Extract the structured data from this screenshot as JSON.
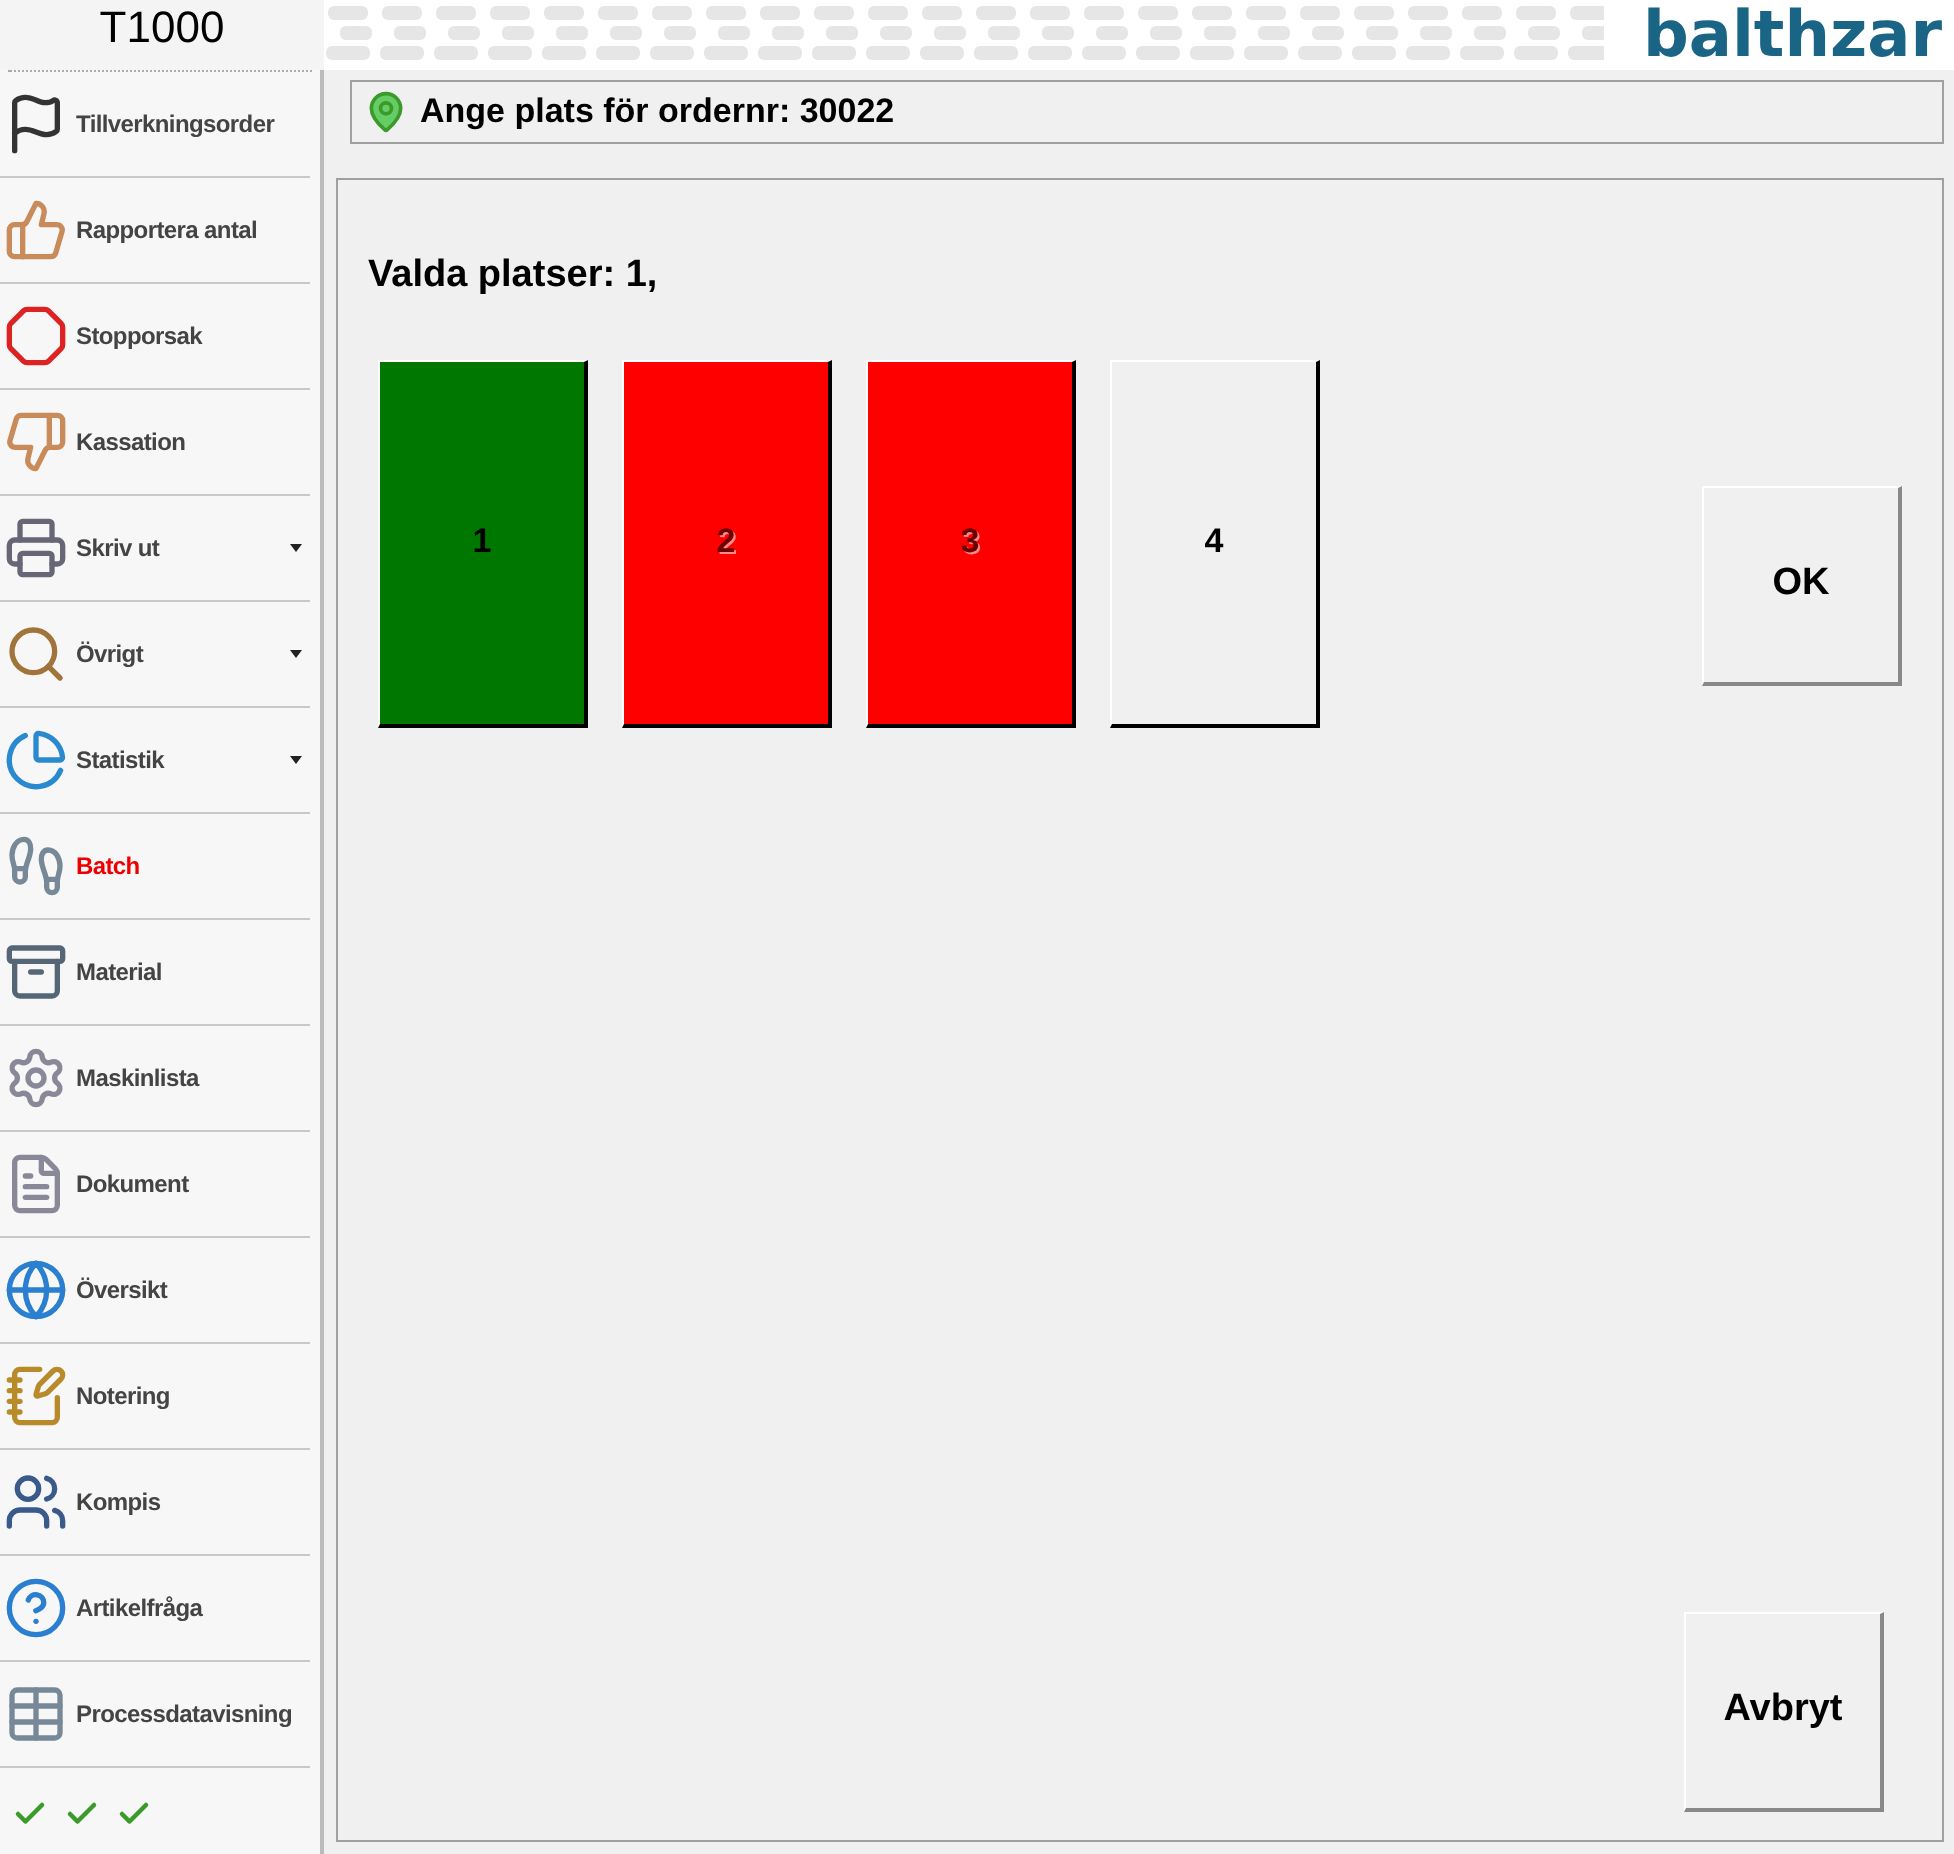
{
  "app_title": "T1000",
  "logo": "balthzar",
  "sidebar": {
    "items": [
      {
        "label": "Tillverkningsorder",
        "selected": false,
        "has_menu": false
      },
      {
        "label": "Rapportera antal",
        "selected": false,
        "has_menu": false
      },
      {
        "label": "Stopporsak",
        "selected": false,
        "has_menu": false
      },
      {
        "label": "Kassation",
        "selected": false,
        "has_menu": false
      },
      {
        "label": "Skriv ut",
        "selected": false,
        "has_menu": true
      },
      {
        "label": "Övrigt",
        "selected": false,
        "has_menu": true
      },
      {
        "label": "Statistik",
        "selected": false,
        "has_menu": true
      },
      {
        "label": "Batch",
        "selected": true,
        "has_menu": false
      },
      {
        "label": "Material",
        "selected": false,
        "has_menu": false
      },
      {
        "label": "Maskinlista",
        "selected": false,
        "has_menu": false
      },
      {
        "label": "Dokument",
        "selected": false,
        "has_menu": false
      },
      {
        "label": "Översikt",
        "selected": false,
        "has_menu": false
      },
      {
        "label": "Notering",
        "selected": false,
        "has_menu": false
      },
      {
        "label": "Kompis",
        "selected": false,
        "has_menu": false
      },
      {
        "label": "Artikelfråga",
        "selected": false,
        "has_menu": false
      },
      {
        "label": "Processdatavisning",
        "selected": false,
        "has_menu": false
      }
    ]
  },
  "header": {
    "title": "Ange plats för ordernr: 30022"
  },
  "selection_label": "Valda platser: 1,",
  "places": [
    {
      "label": "1",
      "color": "#007800",
      "disabled": false
    },
    {
      "label": "2",
      "color": "#ff0000",
      "disabled": true
    },
    {
      "label": "3",
      "color": "#ff0000",
      "disabled": true
    },
    {
      "label": "4",
      "color": "#f0f0f0",
      "disabled": false
    }
  ],
  "buttons": {
    "ok": "OK",
    "cancel": "Avbryt"
  }
}
